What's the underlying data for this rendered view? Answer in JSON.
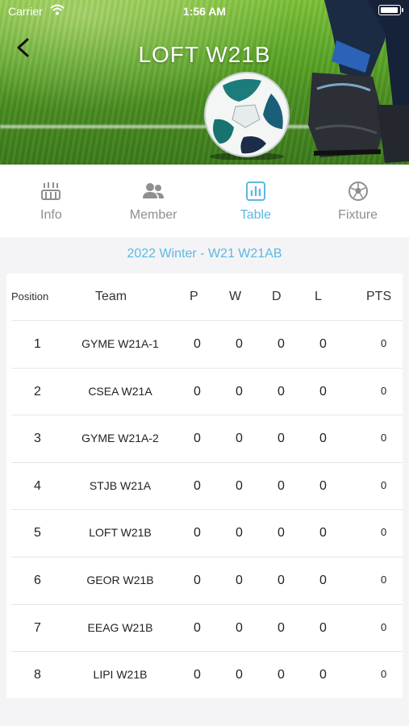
{
  "status_bar": {
    "carrier": "Carrier",
    "time": "1:56 AM"
  },
  "header": {
    "title": "LOFT W21B"
  },
  "tabs": [
    {
      "label": "Info",
      "icon": "stadium-icon",
      "active": false
    },
    {
      "label": "Member",
      "icon": "people-icon",
      "active": false
    },
    {
      "label": "Table",
      "icon": "chart-icon",
      "active": true
    },
    {
      "label": "Fixture",
      "icon": "soccer-ball-icon",
      "active": false
    }
  ],
  "season_label": "2022 Winter - W21 W21AB",
  "table": {
    "headers": {
      "position": "Position",
      "team": "Team",
      "p": "P",
      "w": "W",
      "d": "D",
      "l": "L",
      "pts": "PTS"
    },
    "rows": [
      {
        "position": "1",
        "team": "GYME W21A-1",
        "p": "0",
        "w": "0",
        "d": "0",
        "l": "0",
        "pts": "0"
      },
      {
        "position": "2",
        "team": "CSEA W21A",
        "p": "0",
        "w": "0",
        "d": "0",
        "l": "0",
        "pts": "0"
      },
      {
        "position": "3",
        "team": "GYME W21A-2",
        "p": "0",
        "w": "0",
        "d": "0",
        "l": "0",
        "pts": "0"
      },
      {
        "position": "4",
        "team": "STJB W21A",
        "p": "0",
        "w": "0",
        "d": "0",
        "l": "0",
        "pts": "0"
      },
      {
        "position": "5",
        "team": "LOFT W21B",
        "p": "0",
        "w": "0",
        "d": "0",
        "l": "0",
        "pts": "0"
      },
      {
        "position": "6",
        "team": "GEOR W21B",
        "p": "0",
        "w": "0",
        "d": "0",
        "l": "0",
        "pts": "0"
      },
      {
        "position": "7",
        "team": "EEAG W21B",
        "p": "0",
        "w": "0",
        "d": "0",
        "l": "0",
        "pts": "0"
      },
      {
        "position": "8",
        "team": "LIPI W21B",
        "p": "0",
        "w": "0",
        "d": "0",
        "l": "0",
        "pts": "0"
      }
    ]
  },
  "colors": {
    "accent": "#5bb8e3",
    "inactive": "#8e8e93",
    "background": "#f4f4f6"
  }
}
